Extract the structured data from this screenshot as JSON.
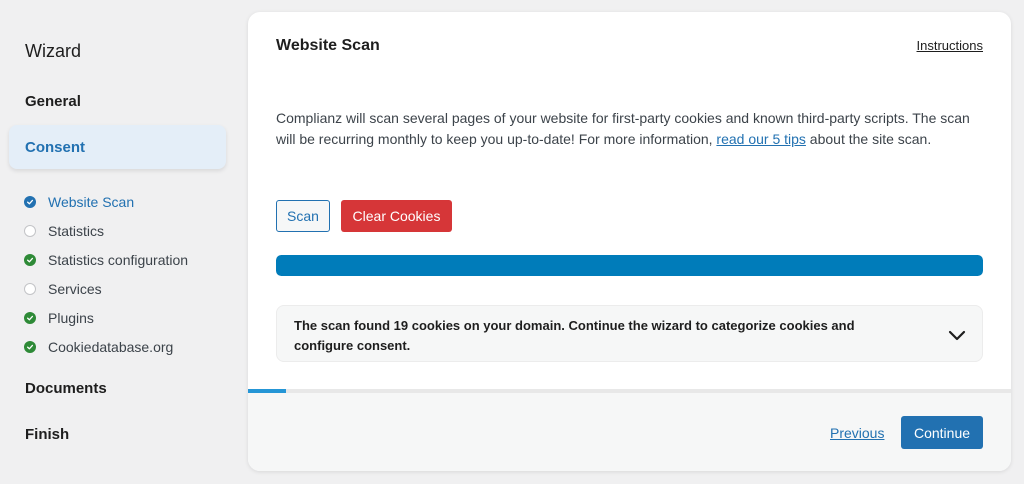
{
  "sidebar": {
    "title": "Wizard",
    "sections": {
      "general": "General",
      "consent": "Consent",
      "documents": "Documents",
      "finish": "Finish"
    },
    "steps": [
      {
        "label": "Website Scan",
        "status": "done",
        "active": true
      },
      {
        "label": "Statistics",
        "status": "empty",
        "active": false
      },
      {
        "label": "Statistics configuration",
        "status": "done",
        "active": false
      },
      {
        "label": "Services",
        "status": "empty",
        "active": false
      },
      {
        "label": "Plugins",
        "status": "done",
        "active": false
      },
      {
        "label": "Cookiedatabase.org",
        "status": "done",
        "active": false
      }
    ]
  },
  "main": {
    "title": "Website Scan",
    "instructions_label": "Instructions",
    "intro": {
      "before_link": "Complianz will scan several pages of your website for first-party cookies and known third-party scripts. The scan will be recurring monthly to keep you up-to-date! For more information, ",
      "link_text": "read our 5 tips",
      "after_link": " about the site scan."
    },
    "buttons": {
      "scan": "Scan",
      "clear_cookies": "Clear Cookies"
    },
    "scan_progress_percent": 100,
    "result_text": "The scan found 19 cookies on your domain. Continue the wizard to categorize cookies and configure consent.",
    "wizard_progress_percent": 5
  },
  "footer": {
    "previous_label": "Previous",
    "continue_label": "Continue"
  },
  "colors": {
    "accent": "#2271b1",
    "danger": "#d63638",
    "success": "#2e8a37",
    "progress": "#007cba"
  },
  "icons": {
    "step_done": "check-circle-icon",
    "step_empty": "empty-circle-icon",
    "result_toggle": "chevron-down-icon"
  }
}
